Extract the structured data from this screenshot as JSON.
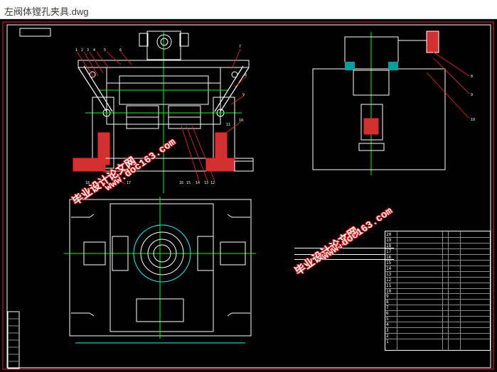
{
  "window": {
    "title": "左阀体镗孔夹具.dwg"
  },
  "watermark": {
    "line1": "毕业设计论文网",
    "line2": "www.doc163.com"
  },
  "colors": {
    "background": "#000000",
    "outline": "#ffffff",
    "center_lines": "#00ff00",
    "section_hatch": "#ff2020",
    "dimension": "#00ffff",
    "part_fill": "#d03030",
    "leader": "#ff2020",
    "border": "#ff0000"
  },
  "drawing": {
    "callouts_front": [
      "1",
      "2",
      "3",
      "4",
      "5",
      "6",
      "7",
      "8",
      "9",
      "10",
      "11",
      "12",
      "13",
      "14",
      "15",
      "16",
      "17",
      "18"
    ],
    "callouts_side": [
      "8",
      "9",
      "10"
    ],
    "bom_rows": [
      "20",
      "19",
      "18",
      "17",
      "16",
      "15",
      "14",
      "13",
      "12",
      "11",
      "10",
      "9",
      "8",
      "7",
      "6",
      "5",
      "4",
      "3",
      "2",
      "1"
    ]
  }
}
